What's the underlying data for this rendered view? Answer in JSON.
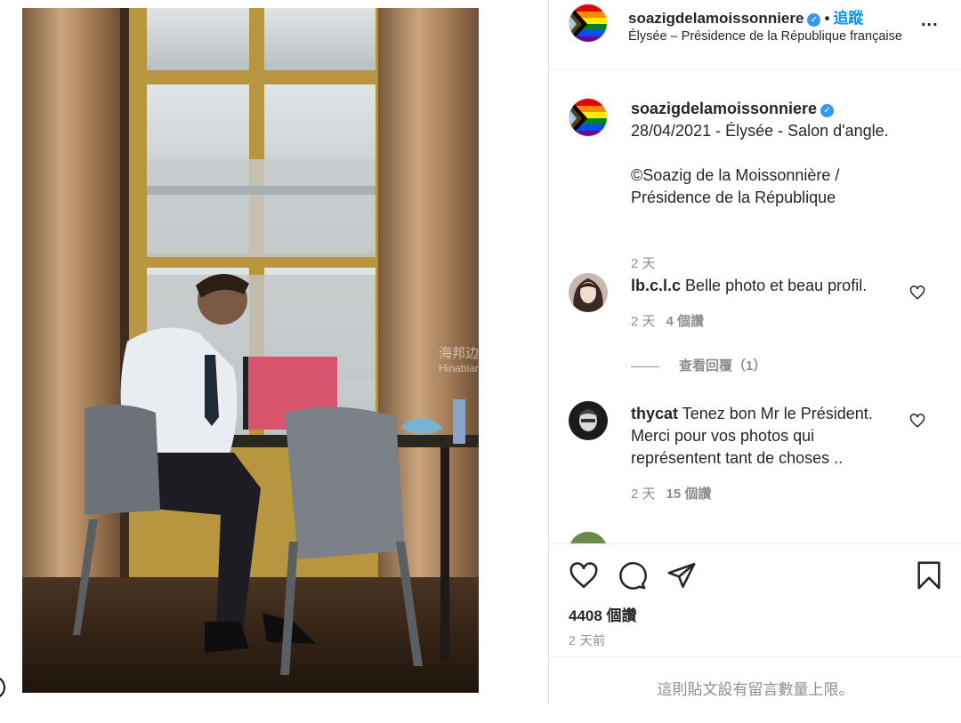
{
  "post": {
    "username": "soazigdelamoissonniere",
    "follow_label": "追蹤",
    "location": "Élysée – Présidence de la République française",
    "more_label": "..."
  },
  "caption": {
    "username": "soazigdelamoissonniere",
    "line1": "28/04/2021 - Élysée - Salon d'angle.",
    "line2": "©Soazig de la Moissonnière /",
    "line3": "Présidence de la République",
    "time": "2 天"
  },
  "comments": [
    {
      "username": "lb.c.l.c",
      "text": "Belle photo et beau profil.",
      "time": "2 天",
      "likes": "4 個讚",
      "view_replies": "查看回覆（1）"
    },
    {
      "username": "thycat",
      "text": "Tenez bon Mr le Président. Merci pour vos photos qui représentent tant de choses ..",
      "time": "2 天",
      "likes": "15 個讚"
    }
  ],
  "actions": {
    "likes_count": "4408 個讚",
    "time_ago": "2 天前",
    "comment_limit": "這則貼文設有留言數量上限。"
  },
  "watermark": {
    "cn": "海邦边",
    "en": "Hinabian"
  },
  "colors": {
    "accent": "#0095f6",
    "verified": "#3897f0",
    "muted": "#8e8e8e",
    "border": "#dbdbdb"
  }
}
